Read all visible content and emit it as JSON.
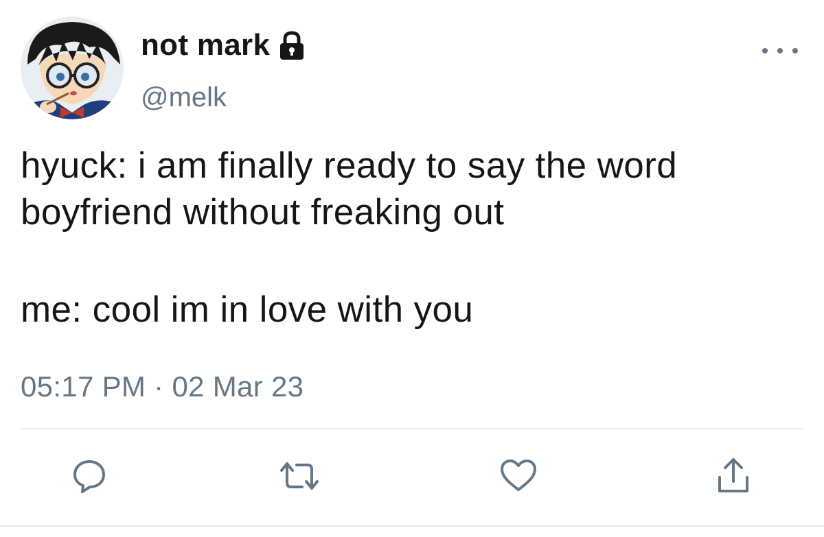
{
  "author": {
    "display_name": "not mark",
    "handle": "@melk",
    "protected_icon": "lock-icon",
    "avatar_icon": "avatar-cartoon-boy-glasses"
  },
  "tweet": {
    "text_lines": [
      "hyuck: i am finally ready to say the word boyfriend without freaking out",
      "me: cool im in love with you"
    ],
    "time": "05:17 PM",
    "separator": "·",
    "date": "02 Mar 23"
  },
  "actions": {
    "more_icon": "more-horizontal-icon",
    "reply_icon": "reply-icon",
    "retweet_icon": "retweet-icon",
    "like_icon": "heart-icon",
    "share_icon": "share-icon"
  },
  "colors": {
    "text": "#14171a",
    "secondary": "#657786",
    "divider": "#e6ecf0"
  }
}
